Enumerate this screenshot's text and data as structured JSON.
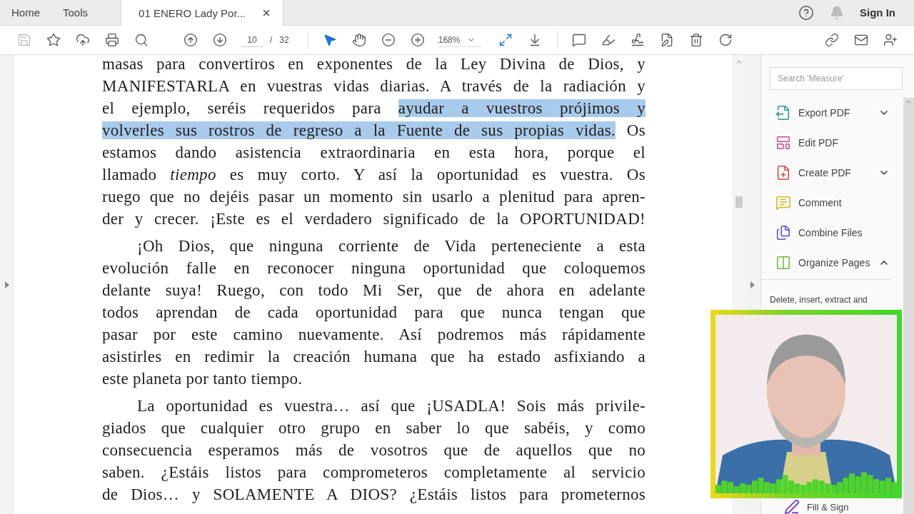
{
  "tabs": [
    {
      "label": "Home",
      "kind": "nav",
      "selected": false
    },
    {
      "label": "Tools",
      "kind": "nav",
      "selected": false
    },
    {
      "label": "01 ENERO Lady Por...",
      "kind": "document",
      "selected": true
    }
  ],
  "header": {
    "sign_in": "Sign In"
  },
  "toolbar": {
    "save_disabled": true,
    "page": "10",
    "separator": "/",
    "page_total": "32",
    "zoom": "168%",
    "pointer_tools": [
      {
        "kind": "select",
        "selected": true
      },
      {
        "kind": "hand",
        "selected": false
      }
    ]
  },
  "document": {
    "paragraphs": [
      {
        "indented": false,
        "last_line_full": true,
        "lines": [
          "masas para convertiros en exponentes de la Ley Divina de Dios, y",
          "MANIFESTARLA en vuestras vidas diarias. A través de la radiación y",
          {
            "parts": [
              {
                "text": "el ejemplo, seréis requeridos para ",
                "highlighted": false
              },
              {
                "text": "ayudar a vuestros prójimos y",
                "highlighted": true
              }
            ]
          },
          {
            "parts": [
              {
                "text": "volverles sus rostros de regreso a la Fuente de sus propias vidas.",
                "highlighted": true
              },
              {
                "text": " Os",
                "highlighted": false
              }
            ]
          },
          "estamos dando asistencia extraordinaria en esta hora, porque el",
          "llamado *tiempo* es muy corto. Y así la oportunidad es vuestra. Os",
          "ruego que no dejéis pasar un momento sin usarlo a plenitud para apren-",
          "der y crecer. ¡Este es el verdadero significado de la OPORTUNIDAD!"
        ]
      },
      {
        "indented": true,
        "last_line_full": false,
        "lines": [
          "¡Oh Dios, que ninguna corriente de Vida perteneciente a esta",
          "evolución falle en reconocer ninguna oportunidad que coloquemos",
          "delante suya! Ruego, con todo Mi Ser, que de ahora en adelante",
          "todos aprendan de cada oportunidad para que nunca tengan que",
          "pasar por este camino nuevamente. Así podremos más rápidamente",
          "asistirles en redimir la creación humana que ha estado asfixiando a",
          "este planeta por tanto tiempo."
        ]
      },
      {
        "indented": true,
        "last_line_full": true,
        "lines": [
          "La oportunidad es vuestra… así que ¡USADLA! Sois más privile-",
          "giados que cualquier otro grupo en saber lo que sabéis, y como",
          "consecuencia esperamos más de vosotros que de aquellos que no",
          "saben. ¿Estáis listos para comprometeros completamente al servicio",
          "de Dios… y SOLAMENTE A DIOS? ¿Estáis listos para prometernos"
        ]
      }
    ]
  },
  "right_panel": {
    "search": {
      "placeholder": "Search 'Measure'"
    },
    "tools": [
      {
        "label": "Export PDF",
        "color": "#2a9a8a",
        "kind": "menu",
        "expanded": false
      },
      {
        "label": "Edit PDF",
        "color": "#d04a86",
        "kind": "tool"
      },
      {
        "label": "Create PDF",
        "color": "#d9484a",
        "kind": "menu",
        "expanded": false
      },
      {
        "label": "Comment",
        "color": "#d8b51c",
        "kind": "tool"
      },
      {
        "label": "Combine Files",
        "color": "#5a4fd6",
        "kind": "tool"
      },
      {
        "label": "Organize Pages",
        "color": "#6cbf3c",
        "kind": "menu",
        "expanded": true
      }
    ],
    "description": "Delete, insert, extract and",
    "footer_tool": {
      "label": "Fill & Sign",
      "color": "#7b3fd1"
    }
  }
}
